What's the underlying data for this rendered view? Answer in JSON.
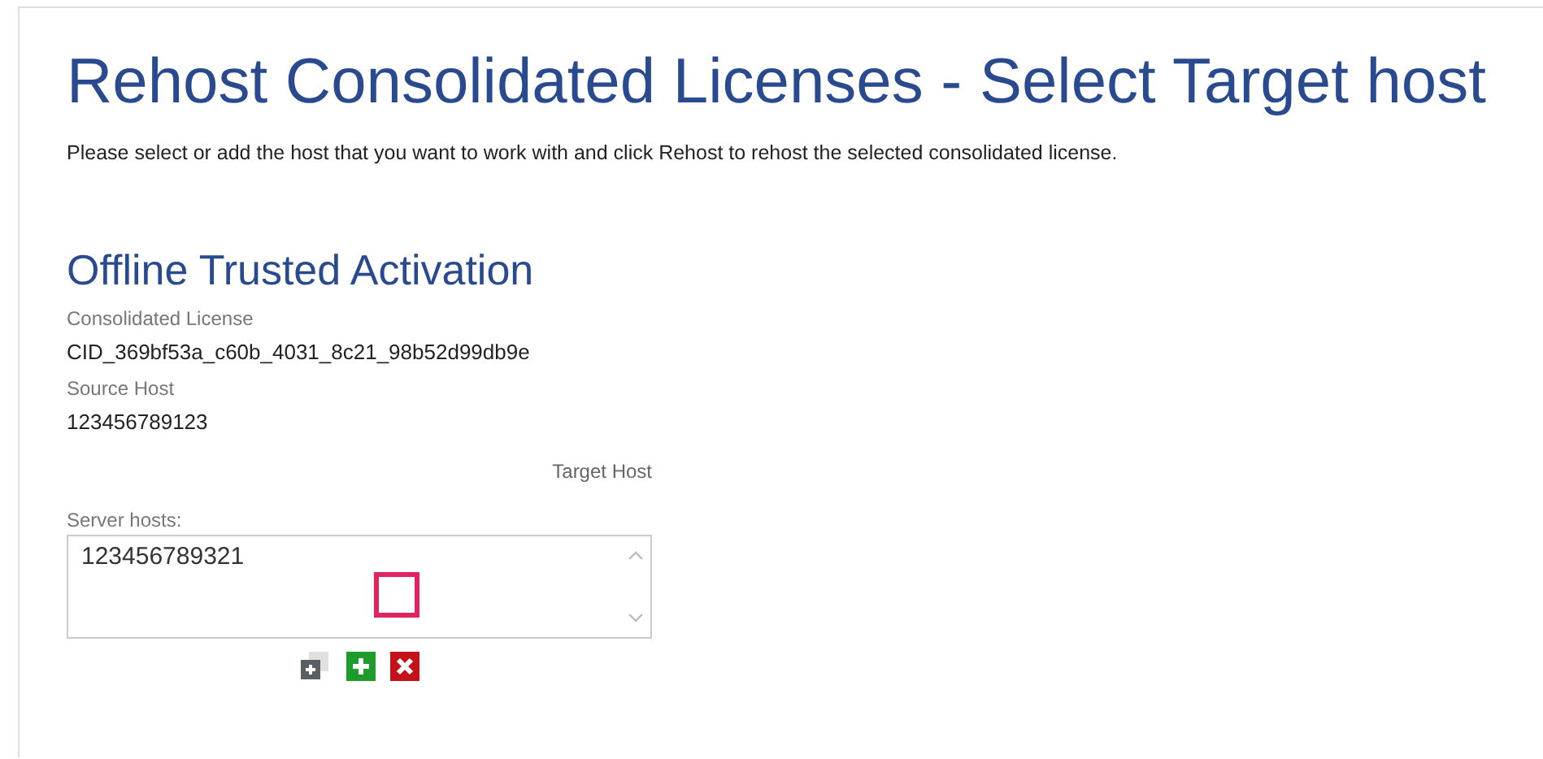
{
  "title": "Rehost Consolidated Licenses - Select Target host",
  "description": "Please select or add the host that you want to work with and click Rehost to rehost the selected consolidated license.",
  "section": {
    "heading": "Offline Trusted Activation",
    "fields": [
      {
        "label": "Consolidated License",
        "value": "CID_369bf53a_c60b_4031_8c21_98b52d99db9e"
      },
      {
        "label": "Source Host",
        "value": "123456789123"
      }
    ],
    "target_label": "Target Host",
    "server_hosts": {
      "label": "Server hosts:",
      "items": [
        "123456789321"
      ]
    },
    "actions": [
      {
        "kind": "add-existing"
      },
      {
        "kind": "add"
      },
      {
        "kind": "remove"
      }
    ]
  }
}
